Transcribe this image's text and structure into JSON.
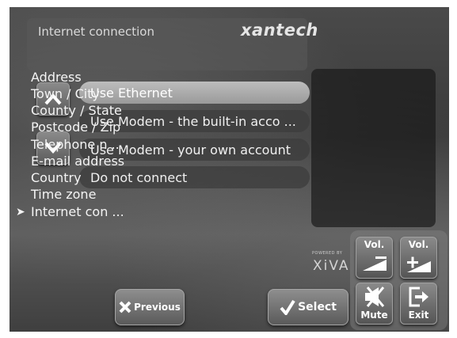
{
  "header": {
    "title": "Internet connection",
    "brand": "xantech"
  },
  "options": [
    {
      "label": "Use Ethernet",
      "selected": true
    },
    {
      "label": "Use Modem - the built-in acco ...",
      "selected": false
    },
    {
      "label": "Use Modem - your own account",
      "selected": false
    },
    {
      "label": "Do not connect",
      "selected": false
    }
  ],
  "menu": {
    "items": [
      "Address",
      "Town / City",
      "County / State",
      "Postcode / Zip",
      "Telephone n ...",
      "E-mail address",
      "Country",
      "Time zone",
      "Internet con ..."
    ],
    "current_index": 8
  },
  "branding": {
    "powered_by": "POWERED BY",
    "xiva": "XiVA"
  },
  "buttons": {
    "previous": "Previous",
    "select": "Select",
    "vol_down": "Vol.",
    "vol_up": "Vol.",
    "mute": "Mute",
    "exit": "Exit"
  },
  "icons": {
    "up": "chevron-up-icon",
    "down": "chevron-down-icon",
    "previous": "x-icon",
    "select": "checkmark-icon",
    "vol_down": "volume-down-icon",
    "vol_up": "volume-up-icon",
    "mute": "mute-icon",
    "exit": "exit-icon",
    "menu_current": "chevron-right-icon"
  }
}
